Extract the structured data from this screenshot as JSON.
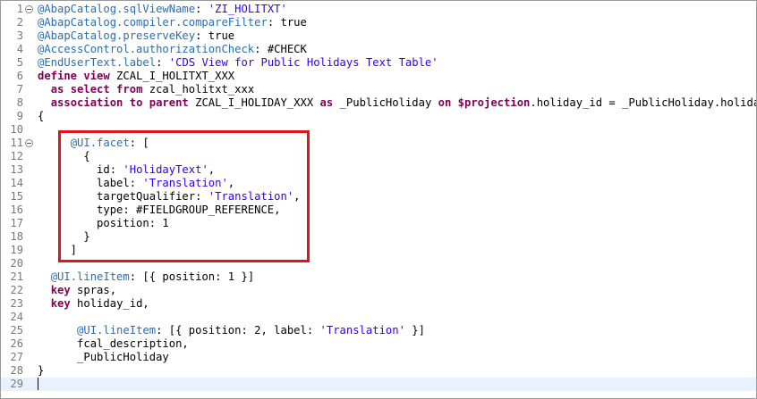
{
  "editor": {
    "lines": [
      {
        "n": "1",
        "text": "@AbapCatalog.sqlViewName: 'ZI_HOLITXT'"
      },
      {
        "n": "2",
        "text": "@AbapCatalog.compiler.compareFilter: true"
      },
      {
        "n": "3",
        "text": "@AbapCatalog.preserveKey: true"
      },
      {
        "n": "4",
        "text": "@AccessControl.authorizationCheck: #CHECK"
      },
      {
        "n": "5",
        "text": "@EndUserText.label: 'CDS View for Public Holidays Text Table'"
      },
      {
        "n": "6",
        "text": "define view ZCAL_I_HOLITXT_XXX"
      },
      {
        "n": "7",
        "text": "  as select from zcal_holitxt_xxx"
      },
      {
        "n": "8",
        "text": "  association to parent ZCAL_I_HOLIDAY_XXX as _PublicHoliday on $projection.holiday_id = _PublicHoliday.holiday_id"
      },
      {
        "n": "9",
        "text": "{"
      },
      {
        "n": "10",
        "text": ""
      },
      {
        "n": "11",
        "text": "     @UI.facet: ["
      },
      {
        "n": "12",
        "text": "       {"
      },
      {
        "n": "13",
        "text": "         id: 'HolidayText',"
      },
      {
        "n": "14",
        "text": "         label: 'Translation',"
      },
      {
        "n": "15",
        "text": "         targetQualifier: 'Translation',"
      },
      {
        "n": "16",
        "text": "         type: #FIELDGROUP_REFERENCE,"
      },
      {
        "n": "17",
        "text": "         position: 1"
      },
      {
        "n": "18",
        "text": "       }"
      },
      {
        "n": "19",
        "text": "     ]"
      },
      {
        "n": "20",
        "text": ""
      },
      {
        "n": "21",
        "text": "  @UI.lineItem: [{ position: 1 }]"
      },
      {
        "n": "22",
        "text": "  key spras,"
      },
      {
        "n": "23",
        "text": "  key holiday_id,"
      },
      {
        "n": "24",
        "text": ""
      },
      {
        "n": "25",
        "text": "      @UI.lineItem: [{ position: 2, label: 'Translation' }]"
      },
      {
        "n": "26",
        "text": "      fcal_description,"
      },
      {
        "n": "27",
        "text": "      _PublicHoliday"
      },
      {
        "n": "28",
        "text": "}"
      },
      {
        "n": "29",
        "text": ""
      }
    ]
  },
  "colors": {
    "highlight_box": "#e0141e",
    "keyword": "#7f0055",
    "string": "#2a00ff",
    "annotation": "#646464",
    "current_line": "#e8f2fe"
  }
}
